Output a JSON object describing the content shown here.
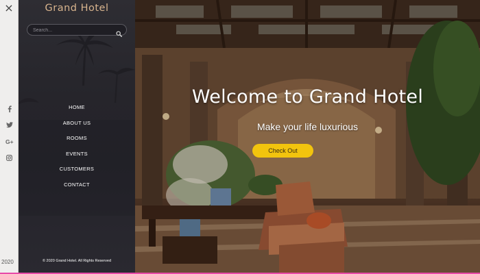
{
  "brand": {
    "name": "Grand Hotel"
  },
  "search": {
    "placeholder": "Search...",
    "icon": "search-icon"
  },
  "rail": {
    "close_glyph": "×",
    "social": [
      "facebook-icon",
      "twitter-icon",
      "google-plus-icon",
      "instagram-icon"
    ],
    "year": "2020"
  },
  "nav": {
    "items": [
      {
        "label": "HOME"
      },
      {
        "label": "ABOUT US"
      },
      {
        "label": "ROOMS"
      },
      {
        "label": "EVENTS"
      },
      {
        "label": "CUSTOMERS"
      },
      {
        "label": "CONTACT"
      }
    ]
  },
  "footer": {
    "copyright": "© 2020 Grand Hotel. All Rights Reserved"
  },
  "hero": {
    "title": "Welcome to Grand Hotel",
    "subtitle": "Make your life luxurious",
    "cta_label": "Check Out"
  },
  "colors": {
    "accent": "#f2c40e",
    "brand_text": "#d8b48e",
    "sidebar_bg": "#26252b"
  }
}
